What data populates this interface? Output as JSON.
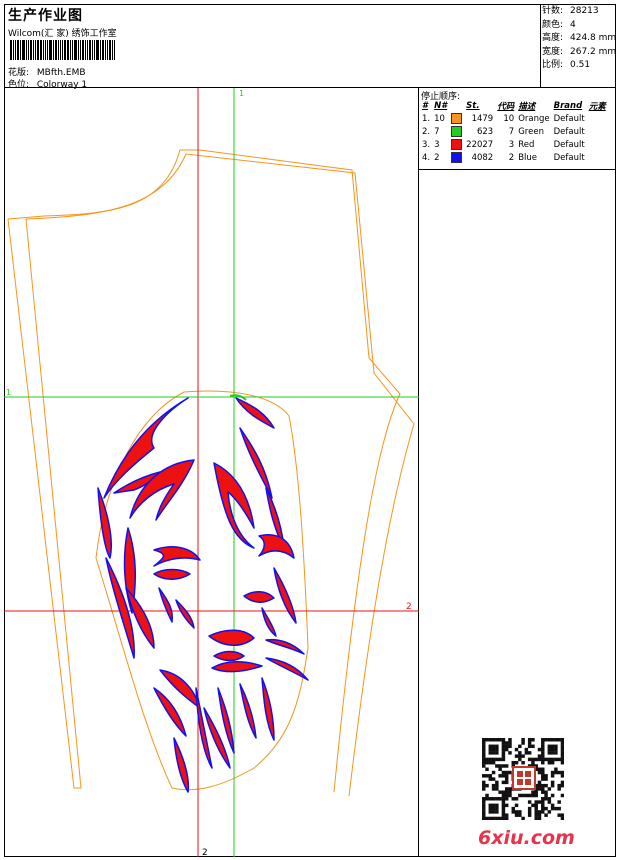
{
  "header": {
    "title": "生产作业图",
    "company": "Wilcom(汇 家) 绣饰工作室",
    "design_label": "花版:",
    "design_value": "MBfth.EMB",
    "colorway_label": "色位:",
    "colorway_value": "Colorway 1"
  },
  "stats": [
    {
      "label": "针数:",
      "value": "28213"
    },
    {
      "label": "颜色:",
      "value": "4"
    },
    {
      "label": "高度:",
      "value": "424.8 mm"
    },
    {
      "label": "宽度:",
      "value": "267.2 mm"
    },
    {
      "label": "比例:",
      "value": "0.51"
    }
  ],
  "legend": {
    "title": "停止顺序:",
    "headers": [
      "#",
      "N#",
      "St.",
      "代码",
      "描述",
      "Brand",
      "元素"
    ],
    "rows": [
      {
        "idx": "1.",
        "n": "10",
        "color": "#f7941d",
        "stitches": "1479",
        "code": "10",
        "desc": "Orange",
        "brand": "Default"
      },
      {
        "idx": "2.",
        "n": "7",
        "color": "#22cc22",
        "stitches": "623",
        "code": "7",
        "desc": "Green",
        "brand": "Default"
      },
      {
        "idx": "3.",
        "n": "3",
        "color": "#ee1111",
        "stitches": "22027",
        "code": "3",
        "desc": "Red",
        "brand": "Default"
      },
      {
        "idx": "4.",
        "n": "2",
        "color": "#1111ee",
        "stitches": "4082",
        "code": "2",
        "desc": "Blue",
        "brand": "Default"
      }
    ]
  },
  "canvas": {
    "guide_labels": {
      "v_top": "1",
      "h_left": "1",
      "h_right": "2",
      "v_bottom": "2"
    },
    "colors": {
      "orange": "#f7941d",
      "green": "#22cc22",
      "red": "#ee1111",
      "blue": "#1111ee"
    }
  },
  "watermark": {
    "text": "6xiu.com"
  },
  "icons": {
    "qr": "qr-code-icon",
    "seal": "seal-stamp-icon"
  }
}
